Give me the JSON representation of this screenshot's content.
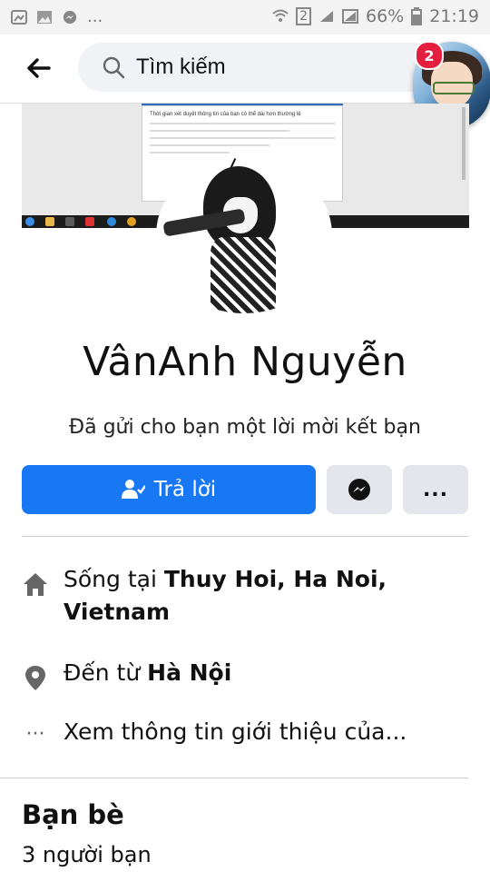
{
  "status_bar": {
    "battery": "66%",
    "time": "21:19",
    "more": "...",
    "sim": "2"
  },
  "header": {
    "search_placeholder": "Tìm kiếm",
    "chat_head_badge": "2"
  },
  "cover": {
    "document_title": "Thời gian xét duyệt thông tin của bạn có thể dài hơn thường lệ"
  },
  "profile": {
    "name": "VânAnh Nguyễn",
    "request_text": "Đã gửi cho bạn một lời mời kết bạn"
  },
  "actions": {
    "reply_label": "Trả lời",
    "more_label": "..."
  },
  "info": {
    "lives_prefix": "Sống tại ",
    "lives_place_line1": "Thuy Hoi, Ha Noi,",
    "lives_place_line2": "Vietnam",
    "from_prefix": "Đến từ ",
    "from_place": "Hà Nội",
    "see_about": "Xem thông tin giới thiệu của...",
    "more_icon_text": "···"
  },
  "friends": {
    "title": "Bạn bè",
    "count": "3 người bạn"
  },
  "colors": {
    "primary": "#1877f2",
    "secondary_button": "#e4e6eb",
    "badge": "#e41e3f"
  },
  "icons": [
    "photo-icon",
    "messenger-icon",
    "wifi-icon",
    "signal-icon",
    "battery-icon",
    "back-arrow-icon",
    "search-icon",
    "add-friend-icon",
    "home-icon",
    "location-pin-icon",
    "more-dots-icon"
  ]
}
